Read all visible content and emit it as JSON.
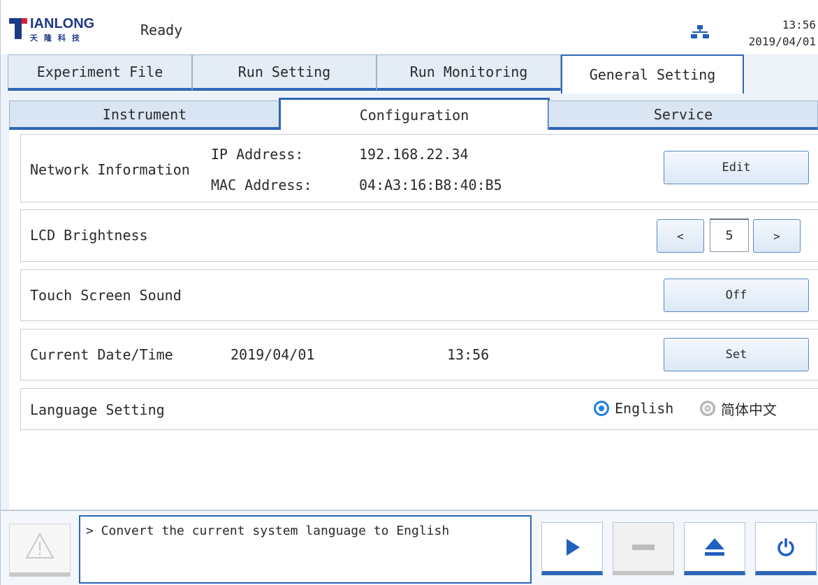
{
  "header": {
    "logo_text": "IANLONG",
    "logo_sub": "天隆科技",
    "status": "Ready",
    "time": "13:56",
    "date": "2019/04/01"
  },
  "main_tabs": [
    {
      "label": "Experiment File"
    },
    {
      "label": "Run Setting"
    },
    {
      "label": "Run Monitoring"
    },
    {
      "label": "General Setting",
      "active": true
    }
  ],
  "sub_tabs": [
    {
      "label": "Instrument"
    },
    {
      "label": "Configuration",
      "active": true
    },
    {
      "label": "Service"
    }
  ],
  "network": {
    "label": "Network Information",
    "ip_label": "IP Address:",
    "ip_value": "192.168.22.34",
    "mac_label": "MAC Address:",
    "mac_value": "04:A3:16:B8:40:B5",
    "button": "Edit"
  },
  "brightness": {
    "label": "LCD Brightness",
    "dec": "<",
    "value": "5",
    "inc": ">"
  },
  "sound": {
    "label": "Touch Screen Sound",
    "button": "Off"
  },
  "datetime": {
    "label": "Current Date/Time",
    "date": "2019/04/01",
    "time": "13:56",
    "button": "Set"
  },
  "language": {
    "label": "Language Setting",
    "options": [
      {
        "label": "English",
        "selected": true
      },
      {
        "label": "简体中文",
        "selected": false
      }
    ]
  },
  "footer": {
    "message": "> Convert the current system language to English",
    "icons": [
      "warning-icon",
      "play-icon",
      "stop-icon",
      "eject-icon",
      "power-icon"
    ],
    "accent": "#2e66b8"
  }
}
